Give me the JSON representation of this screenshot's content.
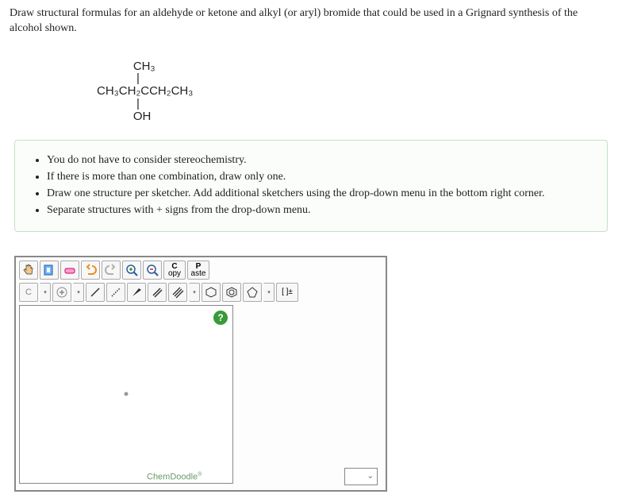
{
  "question": "Draw structural formulas for an aldehyde or ketone and alkyl (or aryl) bromide that could be used in a Grignard synthesis of the alcohol shown.",
  "structure": {
    "line1": "           CH₃",
    "line2": "            |",
    "line3": "CH₃CH₂CCH₂CH₃",
    "line4": "            |",
    "line5": "           OH"
  },
  "hints": [
    "You do not have to consider stereochemistry.",
    "If there is more than one combination, draw only one.",
    "Draw one structure per sketcher. Add additional sketchers using the drop-down menu in the bottom right corner.",
    "Separate structures with + signs from the drop-down menu."
  ],
  "toolbar1": {
    "copy_top": "C",
    "copy_bot": "opy",
    "paste_top": "P",
    "paste_bot": "aste"
  },
  "toolbar2": {
    "element": "C",
    "charges": "[ ]±"
  },
  "help": "?",
  "brand": "ChemDoodle",
  "select_caret": "⌄"
}
